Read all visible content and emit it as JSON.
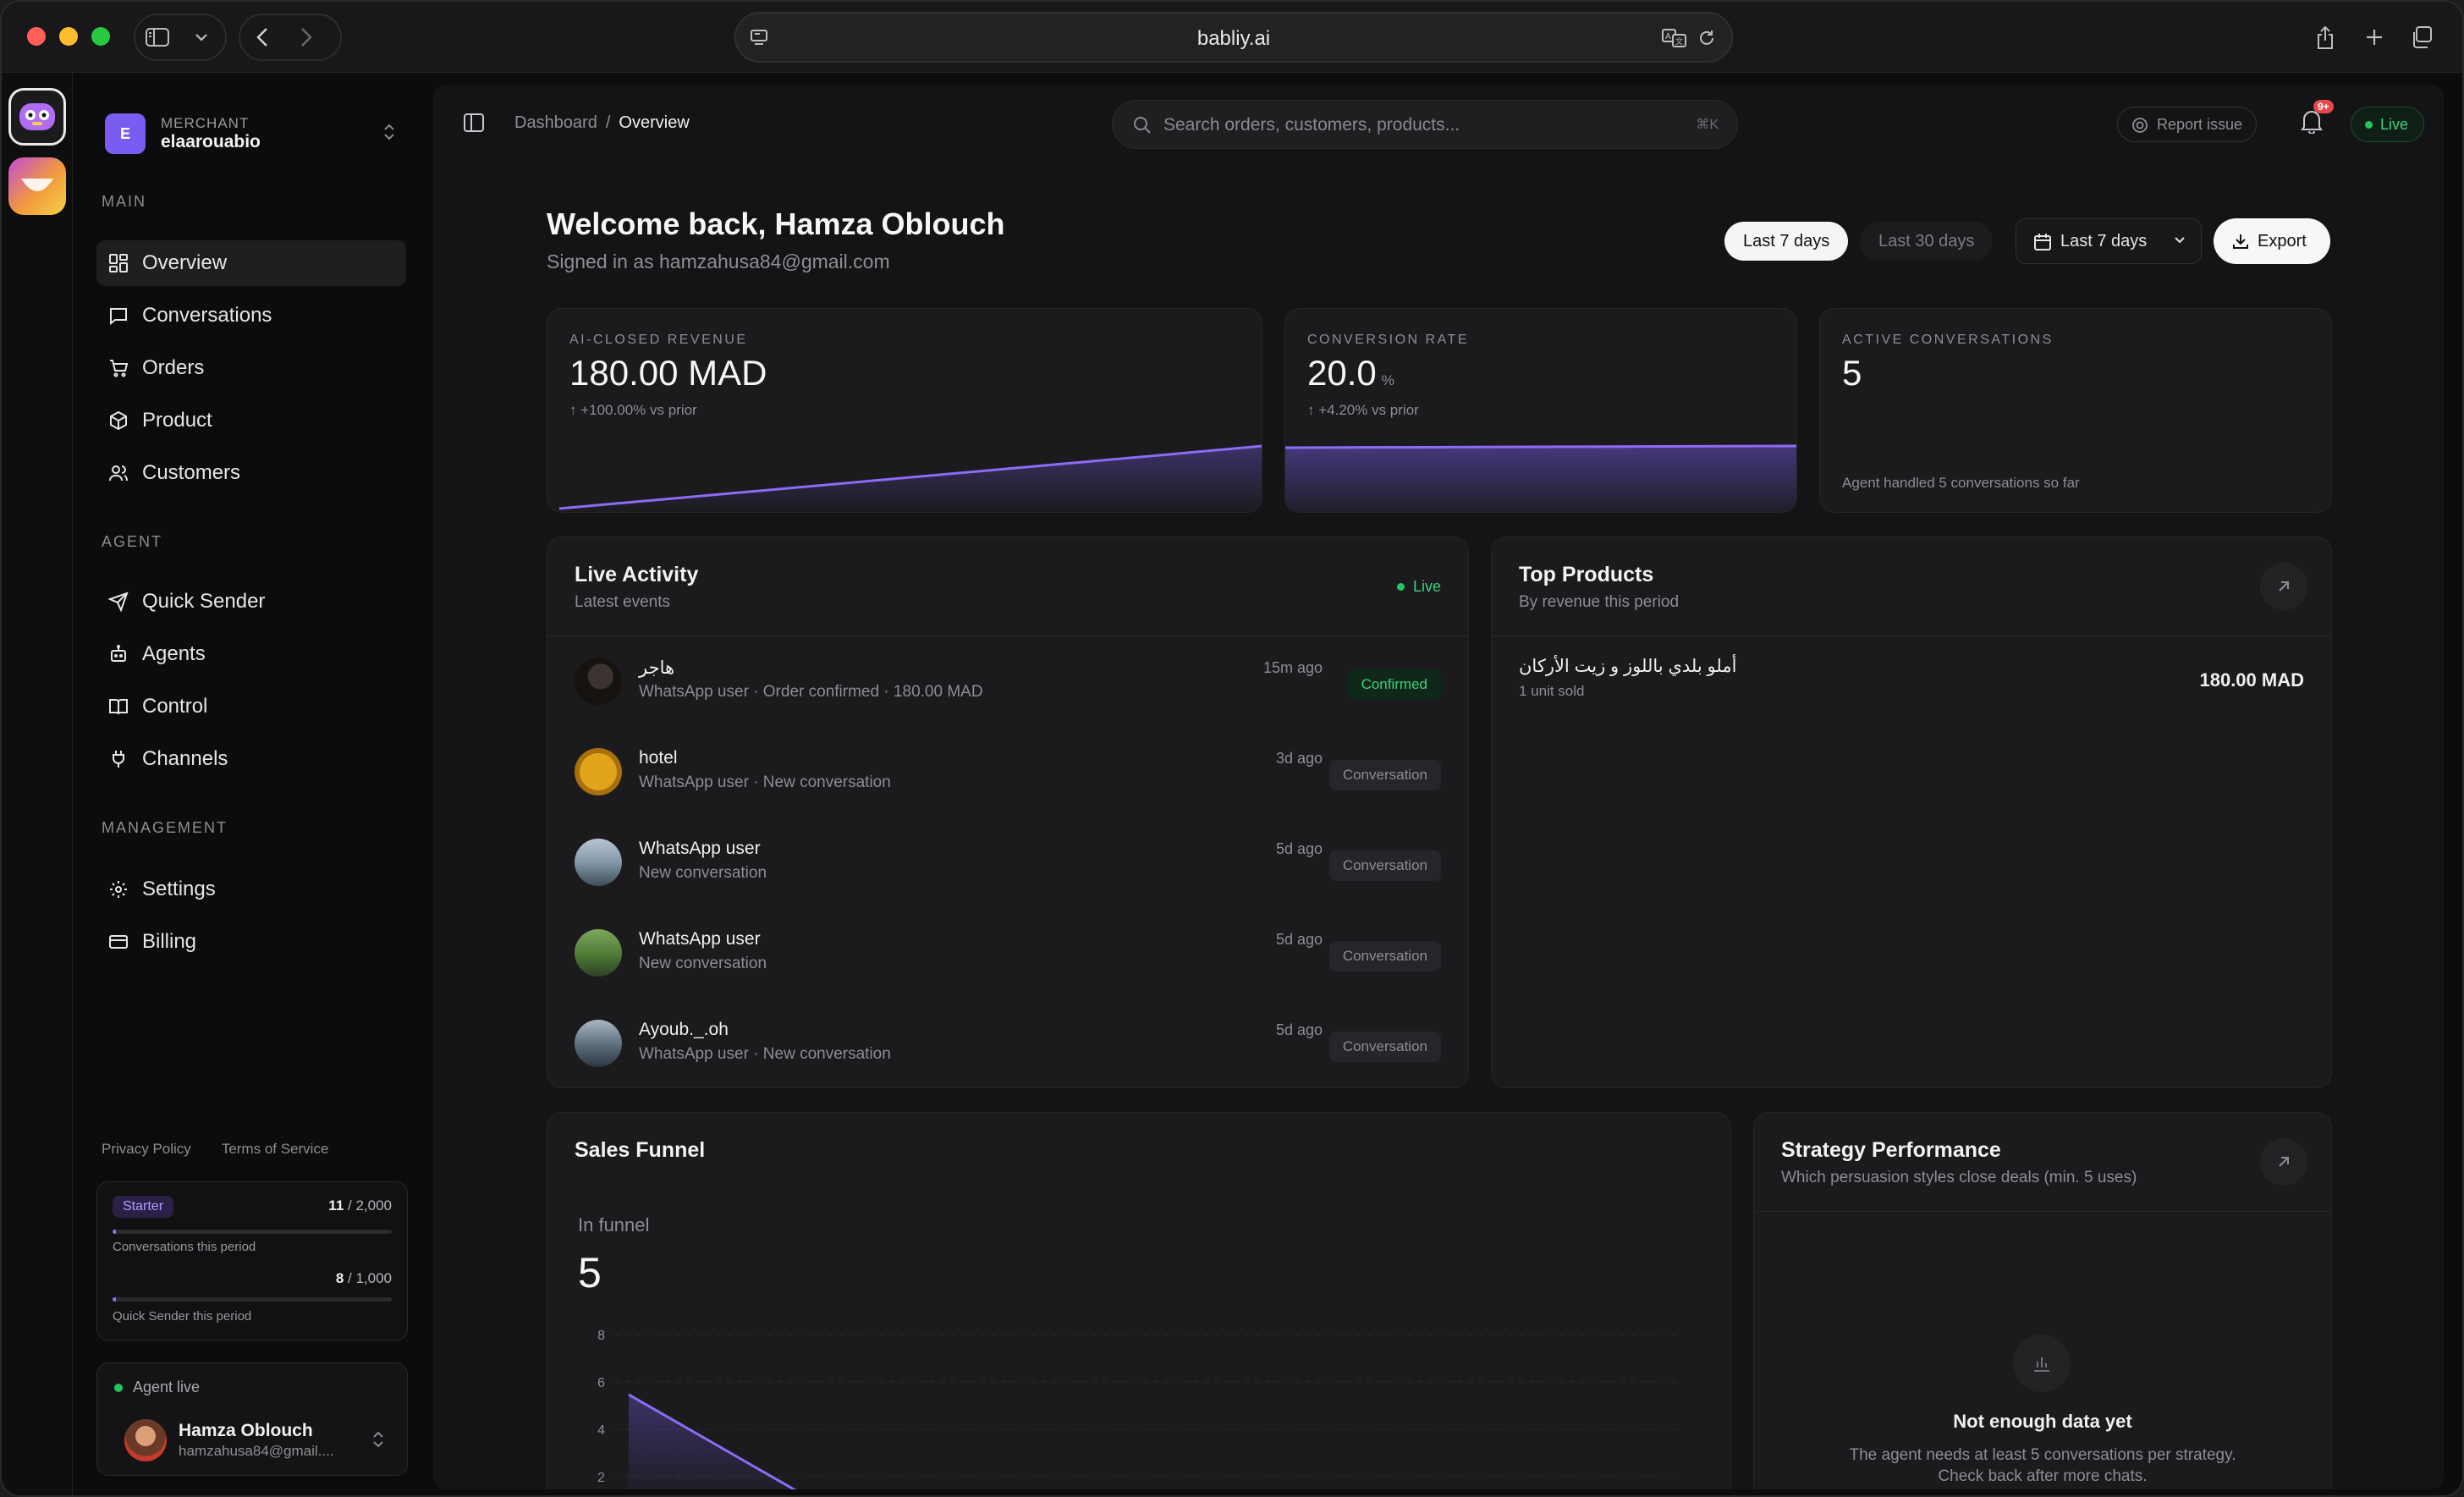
{
  "browser": {
    "url": "babliy.ai"
  },
  "sidebar": {
    "merchant_kicker": "MERCHANT",
    "merchant_name": "elaarouabio",
    "merchant_initial": "E",
    "sections": {
      "main": "MAIN",
      "agent": "AGENT",
      "management": "MANAGEMENT"
    },
    "items": [
      {
        "label": "Overview",
        "icon": "grid-icon"
      },
      {
        "label": "Conversations",
        "icon": "message-icon"
      },
      {
        "label": "Orders",
        "icon": "cart-icon"
      },
      {
        "label": "Product",
        "icon": "box-icon"
      },
      {
        "label": "Customers",
        "icon": "users-icon"
      },
      {
        "label": "Quick Sender",
        "icon": "send-icon"
      },
      {
        "label": "Agents",
        "icon": "bot-icon"
      },
      {
        "label": "Control",
        "icon": "book-icon"
      },
      {
        "label": "Channels",
        "icon": "plug-icon"
      },
      {
        "label": "Settings",
        "icon": "gear-icon"
      },
      {
        "label": "Billing",
        "icon": "card-icon"
      }
    ],
    "legal": {
      "privacy": "Privacy Policy",
      "terms": "Terms of Service"
    },
    "usage": {
      "plan": "Starter",
      "conversations_used": "11",
      "conversations_limit": " / 2,000",
      "conversations_label": "Conversations this period",
      "conversations_fraction": 0.0055,
      "quick_used": "8",
      "quick_limit": " / 1,000",
      "quick_label": "Quick Sender this period",
      "quick_fraction": 0.008
    },
    "agent": {
      "status": "Agent live",
      "name": "Hamza Oblouch",
      "email": "hamzahusa84@gmail...."
    }
  },
  "topbar": {
    "breadcrumb_root": "Dashboard",
    "breadcrumb_sep": "/",
    "breadcrumb_current": "Overview",
    "search_placeholder": "Search orders, customers, products...",
    "search_shortcut": "⌘K",
    "report": "Report issue",
    "notif_badge": "9+",
    "live": "Live"
  },
  "header": {
    "welcome": "Welcome back, Hamza Oblouch",
    "signed_in": "Signed in as hamzahusa84@gmail.com",
    "range_active": "Last 7 days",
    "range_other": "Last 30 days",
    "range_dropdown": "Last 7 days",
    "export": "Export"
  },
  "kpis": {
    "revenue": {
      "label": "AI-CLOSED REVENUE",
      "value": "180.00 MAD",
      "delta": "↑ +100.00% vs prior"
    },
    "conversion": {
      "label": "CONVERSION RATE",
      "value": "20.0",
      "unit": "%",
      "delta": "↑ +4.20% vs prior"
    },
    "active": {
      "label": "ACTIVE CONVERSATIONS",
      "value": "5",
      "note": "Agent handled 5 conversations so far"
    }
  },
  "activity": {
    "title": "Live Activity",
    "subtitle": "Latest events",
    "live": "Live",
    "rows": [
      {
        "name": "هاجر",
        "desc": "WhatsApp user · Order confirmed · 180.00 MAD",
        "time": "15m ago",
        "badge": "Confirmed",
        "status": "confirmed"
      },
      {
        "name": "hotel",
        "desc": "WhatsApp user · New conversation",
        "time": "3d ago",
        "badge": "Conversation",
        "status": "conversation"
      },
      {
        "name": "WhatsApp user",
        "desc": "New conversation",
        "time": "5d ago",
        "badge": "Conversation",
        "status": "conversation"
      },
      {
        "name": "WhatsApp user",
        "desc": "New conversation",
        "time": "5d ago",
        "badge": "Conversation",
        "status": "conversation"
      },
      {
        "name": "Ayoub._.oh",
        "desc": "WhatsApp user · New conversation",
        "time": "5d ago",
        "badge": "Conversation",
        "status": "conversation"
      }
    ]
  },
  "top_products": {
    "title": "Top Products",
    "subtitle": "By revenue this period",
    "items": [
      {
        "name": "أملو بلدي باللوز و زيت الأركان",
        "units": "1 unit sold",
        "value": "180.00 MAD"
      }
    ]
  },
  "funnel": {
    "title": "Sales Funnel",
    "inner_label": "In funnel",
    "value": "5",
    "axis_ticks": [
      "8",
      "6",
      "4",
      "2"
    ]
  },
  "strategy": {
    "title": "Strategy Performance",
    "subtitle": "Which persuasion styles close deals (min. 5 uses)",
    "empty_title": "Not enough data yet",
    "empty_desc_1": "The agent needs at least 5 conversations per strategy.",
    "empty_desc_2": "Check back after more chats."
  },
  "colors": {
    "accent": "#7b5cf0",
    "live": "#22c55e",
    "background": "#0c0c0d",
    "card": "#1b1b1e"
  }
}
